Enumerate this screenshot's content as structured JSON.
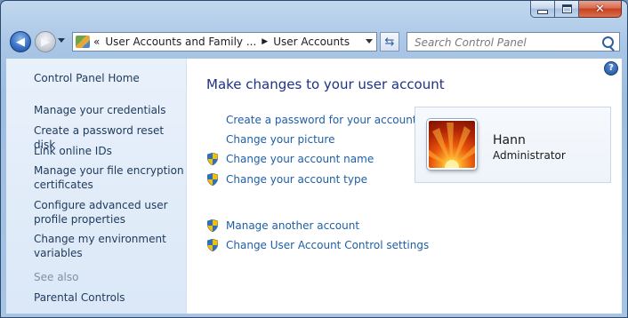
{
  "window": {
    "caption_min": "Minimize",
    "caption_max": "Maximize",
    "caption_close": "Close"
  },
  "address": {
    "chevron": "«",
    "crumb1": "User Accounts and Family ...",
    "crumb2": "User Accounts"
  },
  "search": {
    "placeholder": "Search Control Panel"
  },
  "sidebar": {
    "home": "Control Panel Home",
    "items": [
      {
        "label": "Manage your credentials"
      },
      {
        "label": "Create a password reset disk"
      },
      {
        "label": "Link online IDs"
      },
      {
        "label": "Manage your file encryption certificates"
      },
      {
        "label": "Configure advanced user profile properties"
      },
      {
        "label": "Change my environment variables"
      }
    ],
    "see_also": "See also",
    "partial_item": "Parental Controls"
  },
  "main": {
    "title": "Make changes to your user account",
    "tasks": [
      {
        "label": "Create a password for your account",
        "shield": false
      },
      {
        "label": "Change your picture",
        "shield": false
      },
      {
        "label": "Change your account name",
        "shield": true
      },
      {
        "label": "Change your account type",
        "shield": true
      },
      {
        "label": "Manage another account",
        "shield": true
      },
      {
        "label": "Change User Account Control settings",
        "shield": true
      }
    ]
  },
  "user": {
    "name": "Hann",
    "role": "Administrator"
  },
  "colors": {
    "link": "#1e5fa6",
    "title": "#1e3287",
    "sidebar_text": "#1e395b"
  }
}
